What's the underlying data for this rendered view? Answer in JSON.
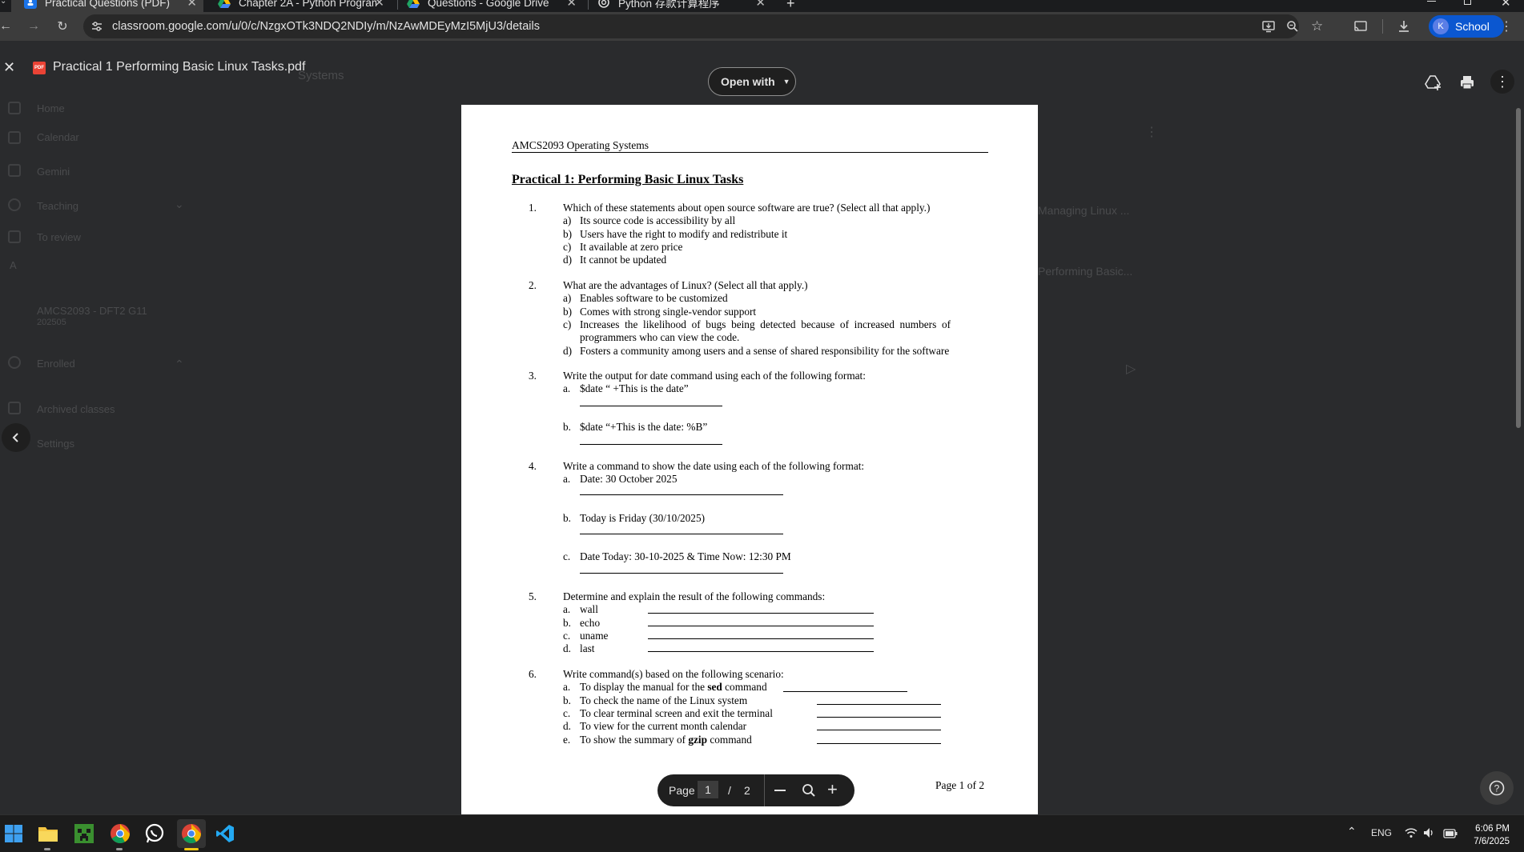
{
  "browser": {
    "tabs": [
      {
        "title": "Practical Questions (PDF)",
        "active": true
      },
      {
        "title": "Chapter 2A - Python Programm",
        "active": false
      },
      {
        "title": "Questions - Google Drive",
        "active": false
      },
      {
        "title": "Python 存款计算程序",
        "active": false
      }
    ],
    "url": "classroom.google.com/u/0/c/NzgxOTk3NDQ2NDIy/m/NzAwMDEyMzI5MjU3/details",
    "profile_label": "School",
    "profile_initial": "K"
  },
  "classroom_bg": {
    "faded_title": "Systems",
    "nav": [
      {
        "label": "Home"
      },
      {
        "label": "Calendar"
      },
      {
        "label": "Gemini"
      },
      {
        "label": "Teaching"
      },
      {
        "label": "To review"
      },
      {
        "label": "AMCS2093 - DFT2 G11"
      },
      {
        "label": "202505"
      },
      {
        "label": "Enrolled"
      },
      {
        "label": "Archived classes"
      },
      {
        "label": "Settings"
      }
    ],
    "right_items": [
      "Managing Linux ...",
      "Performing Basic..."
    ]
  },
  "viewer": {
    "file_name": "Practical 1 Performing Basic Linux Tasks.pdf",
    "open_with_label": "Open with",
    "page_label": "Page",
    "current_page": "1",
    "page_sep": "/",
    "total_pages": "2"
  },
  "document": {
    "course_header": "AMCS2093 Operating Systems",
    "title": "Practical 1: Performing Basic Linux Tasks",
    "questions": [
      {
        "num": "1.",
        "text": "Which of these statements about open source software are true? (Select all that apply.)",
        "items": [
          {
            "label": "a)",
            "text": "Its source code is accessibility by all"
          },
          {
            "label": "b)",
            "text": "Users have the right to modify and redistribute it"
          },
          {
            "label": "c)",
            "text": "It available at zero price"
          },
          {
            "label": "d)",
            "text": "It cannot be updated"
          }
        ]
      },
      {
        "num": "2.",
        "text": "What are the advantages of Linux? (Select all that apply.)",
        "items": [
          {
            "label": "a)",
            "text": "Enables software to be customized"
          },
          {
            "label": "b)",
            "text": "Comes with strong single-vendor support"
          },
          {
            "label": "c)",
            "text": "Increases  the  likelihood  of  bugs  being  detected  because  of  increased  numbers  of",
            "cont": "programmers who can view the code."
          },
          {
            "label": "d)",
            "text": "Fosters a community among users and a sense of shared responsibility for the software"
          }
        ]
      },
      {
        "num": "3.",
        "text": "Write the output for date command using each of the following format:",
        "items": [
          {
            "label": "a.",
            "text": "$date “ +This is the date”"
          },
          {
            "label": "b.",
            "text": "$date “+This is the date: %B”"
          }
        ]
      },
      {
        "num": "4.",
        "text": "Write a command to show the date using each of the following format:",
        "items": [
          {
            "label": "a.",
            "text": "Date: 30 October 2025"
          },
          {
            "label": "b.",
            "text": "Today is Friday (30/10/2025)"
          },
          {
            "label": "c.",
            "text": "Date Today: 30-10-2025 & Time Now: 12:30 PM"
          }
        ]
      },
      {
        "num": "5.",
        "text": "Determine and explain the result of the following commands:",
        "items": [
          {
            "label": "a.",
            "text": "wall"
          },
          {
            "label": "b.",
            "text": "echo"
          },
          {
            "label": "c.",
            "text": "uname"
          },
          {
            "label": "d.",
            "text": "last"
          }
        ]
      },
      {
        "num": "6.",
        "text": "Write command(s) based on the following scenario:",
        "items": [
          {
            "label": "a.",
            "pre": "To display the manual for the ",
            "bold": "sed",
            "post": " command"
          },
          {
            "label": "b.",
            "pre": "To check the name of the Linux system",
            "bold": "",
            "post": ""
          },
          {
            "label": "c.",
            "pre": "To clear terminal screen and exit the terminal",
            "bold": "",
            "post": ""
          },
          {
            "label": "d.",
            "pre": "To view for the current month calendar",
            "bold": "",
            "post": ""
          },
          {
            "label": "e.",
            "pre": "To show the summary of ",
            "bold": "gzip",
            "post": " command"
          }
        ]
      }
    ],
    "footer": "Page 1 of 2"
  },
  "taskbar": {
    "language": "ENG",
    "time": "6:06 PM",
    "date": "7/6/2025"
  }
}
